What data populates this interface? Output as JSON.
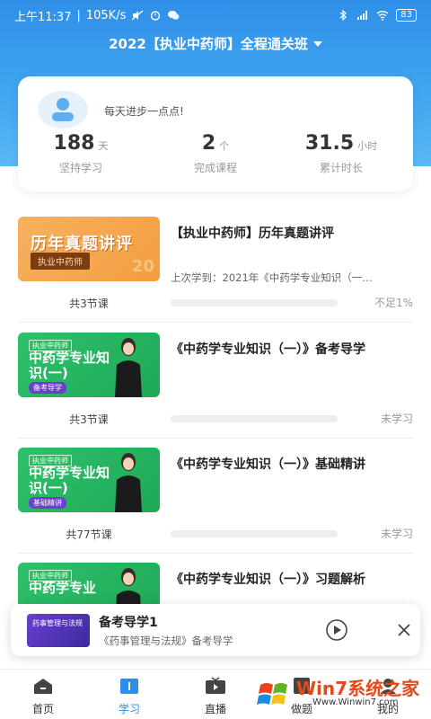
{
  "status_bar": {
    "time": "上午11:37",
    "speed": "105K/s",
    "battery": "83"
  },
  "header": {
    "class_title": "2022【执业中药师】全程通关班"
  },
  "stats": {
    "motto": "每天进步一点点!",
    "items": [
      {
        "value": "188",
        "unit": "天",
        "label": "坚持学习"
      },
      {
        "value": "2",
        "unit": "个",
        "label": "完成课程"
      },
      {
        "value": "31.5",
        "unit": "小时",
        "label": "累计时长"
      }
    ]
  },
  "courses": [
    {
      "thumb_text": "历年真题讲评",
      "thumb_pill": "执业中药师",
      "title": "【执业中药师】历年真题讲评",
      "subtitle": "上次学到：2021年《中药学专业知识（一…",
      "lessons": "共3节课",
      "progress_text": "不足1%",
      "progress": 0.0
    },
    {
      "thumb_tag": "执业中药师",
      "thumb_text": "中药学专业知识(一)",
      "thumb_pill": "备考导学",
      "title": "《中药学专业知识（一）》备考导学",
      "subtitle": "",
      "lessons": "共3节课",
      "progress_text": "未学习",
      "progress": 0.0
    },
    {
      "thumb_tag": "执业中药师",
      "thumb_text": "中药学专业知识(一)",
      "thumb_pill": "基础精讲",
      "title": "《中药学专业知识（一）》基础精讲",
      "subtitle": "",
      "lessons": "共77节课",
      "progress_text": "未学习",
      "progress": 0.0
    },
    {
      "thumb_tag": "执业中药师",
      "thumb_text": "中药学专业",
      "title": "《中药学专业知识（一）》习题解析"
    }
  ],
  "mini_player": {
    "thumb_text": "药事管理与法规",
    "title": "备考导学1",
    "subtitle": "《药事管理与法规》备考导学"
  },
  "tabs": [
    {
      "label": "首页",
      "icon": "home-icon"
    },
    {
      "label": "学习",
      "icon": "study-icon",
      "active": true
    },
    {
      "label": "直播",
      "icon": "live-tv-icon"
    },
    {
      "label": "做题",
      "icon": "question-icon"
    },
    {
      "label": "我的",
      "icon": "profile-icon"
    }
  ],
  "watermark": {
    "name": "Win7系统之家",
    "site": "Www.Winwin7.com"
  },
  "colors": {
    "brand_blue": "#2f8fe8",
    "course_green": "#2fc06a",
    "course_orange": "#f49d3f"
  }
}
